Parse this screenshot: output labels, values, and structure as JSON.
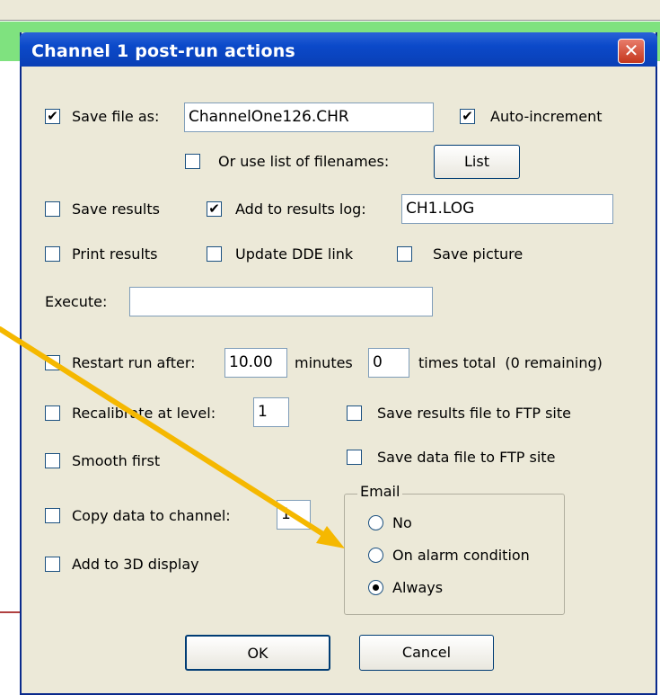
{
  "window": {
    "title": "Channel 1 post-run actions",
    "close_glyph": "✕"
  },
  "save_file": {
    "checked": true,
    "label": "Save file as:",
    "value": "ChannelOne126.CHR"
  },
  "auto_increment": {
    "checked": true,
    "label": "Auto-increment"
  },
  "use_list": {
    "checked": false,
    "label": "Or use list of filenames:",
    "button_label": "List"
  },
  "save_results": {
    "checked": false,
    "label": "Save results"
  },
  "add_results_log": {
    "checked": true,
    "label": "Add to results log:",
    "value": "CH1.LOG"
  },
  "print_results": {
    "checked": false,
    "label": "Print results"
  },
  "update_dde": {
    "checked": false,
    "label": "Update DDE link"
  },
  "save_picture": {
    "checked": false,
    "label": "Save picture"
  },
  "execute": {
    "label": "Execute:",
    "value": ""
  },
  "restart_run": {
    "checked": false,
    "label": "Restart run after:",
    "minutes_value": "10.00",
    "minutes_label": "minutes",
    "times_value": "0",
    "times_label": "times total  (0 remaining)"
  },
  "recalibrate": {
    "checked": false,
    "label": "Recalibrate at level:",
    "value": "1"
  },
  "save_results_ftp": {
    "checked": false,
    "label": "Save results file to FTP site"
  },
  "smooth_first": {
    "checked": false,
    "label": "Smooth first"
  },
  "save_data_ftp": {
    "checked": false,
    "label": "Save data file to FTP site"
  },
  "copy_data": {
    "checked": false,
    "label": "Copy data to channel:",
    "value": "1"
  },
  "add_3d": {
    "checked": false,
    "label": "Add to 3D display"
  },
  "email": {
    "legend": "Email",
    "options": [
      {
        "label": "No",
        "selected": false
      },
      {
        "label": "On alarm condition",
        "selected": false
      },
      {
        "label": "Always",
        "selected": true
      }
    ]
  },
  "buttons": {
    "ok": "OK",
    "cancel": "Cancel"
  },
  "check_glyph": "✔",
  "colors": {
    "title_bar": "#0b49c9",
    "dialog_bg": "#ece9d8",
    "arrow": "#f5b800",
    "close_button": "#c4361c",
    "toolbar_strip": "#7fe27f"
  }
}
